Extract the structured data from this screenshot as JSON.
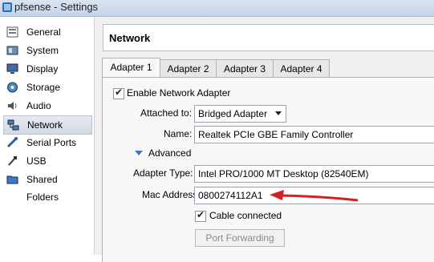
{
  "window": {
    "title": "pfsense - Settings"
  },
  "sidebar": {
    "items": [
      {
        "label": "General",
        "icon": "general-icon"
      },
      {
        "label": "System",
        "icon": "system-icon"
      },
      {
        "label": "Display",
        "icon": "display-icon"
      },
      {
        "label": "Storage",
        "icon": "storage-icon"
      },
      {
        "label": "Audio",
        "icon": "audio-icon"
      },
      {
        "label": "Network",
        "icon": "network-icon",
        "selected": true
      },
      {
        "label": "Serial Ports",
        "icon": "serial-ports-icon"
      },
      {
        "label": "USB",
        "icon": "usb-icon"
      },
      {
        "label": "Shared Folders",
        "icon": "shared-folders-icon"
      }
    ]
  },
  "header": {
    "title": "Network"
  },
  "tabs": [
    {
      "label": "Adapter 1",
      "active": true
    },
    {
      "label": "Adapter 2"
    },
    {
      "label": "Adapter 3"
    },
    {
      "label": "Adapter 4"
    }
  ],
  "adapter": {
    "enable_label": "Enable Network Adapter",
    "enable_checked": true,
    "attached_label": "Attached to:",
    "attached_value": "Bridged Adapter",
    "name_label": "Name:",
    "name_value": "Realtek PCIe GBE Family Controller",
    "advanced_label": "Advanced",
    "adapter_type_label": "Adapter Type:",
    "adapter_type_value": "Intel PRO/1000 MT Desktop (82540EM)",
    "mac_label": "Mac Address:",
    "mac_value": "0800274112A1",
    "cable_label": "Cable connected",
    "cable_checked": true,
    "port_forwarding_label": "Port Forwarding"
  },
  "colors": {
    "annotation_arrow": "#d42020",
    "expander": "#3c78c8"
  }
}
